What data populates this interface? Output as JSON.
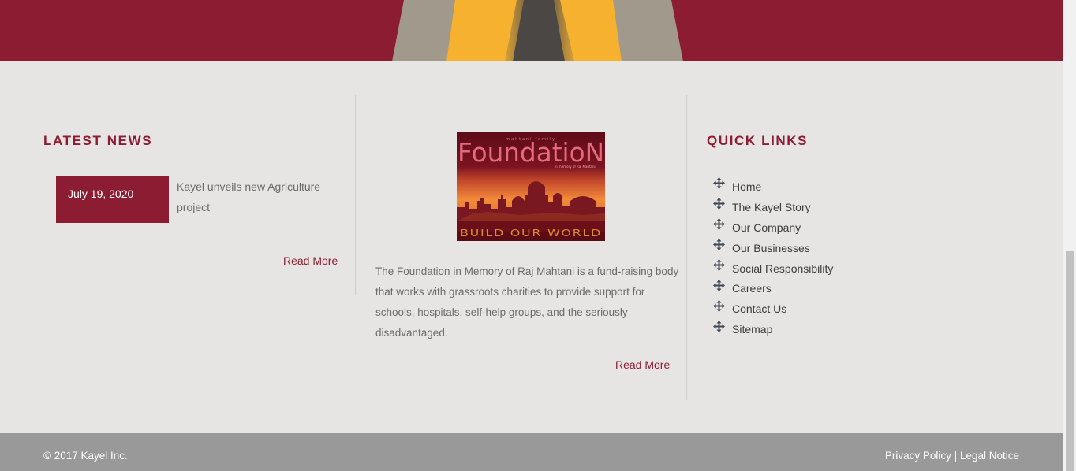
{
  "colors": {
    "brand": "#8b1c31",
    "background": "#e6e5e3",
    "footer": "#999999"
  },
  "latest_news": {
    "title": "LATEST NEWS",
    "items": [
      {
        "date": "July 19, 2020",
        "title": "Kayel unveils new Agriculture project"
      }
    ],
    "read_more": "Read More"
  },
  "foundation": {
    "image": {
      "small_caption": "mahtani family",
      "title": "FoundatioN",
      "sub_caption": "in memory of Raj Mahtani",
      "tagline": "BUILD OUR WORLD"
    },
    "description": "The Foundation in Memory of Raj Mahtani is a fund-raising body that works with grassroots charities to provide support for schools, hospitals, self-help groups, and the seriously disadvantaged.",
    "read_more": "Read More"
  },
  "quick_links": {
    "title": "QUICK LINKS",
    "icon": "move-arrows-icon",
    "items": [
      {
        "label": "Home"
      },
      {
        "label": "The Kayel Story"
      },
      {
        "label": "Our Company"
      },
      {
        "label": "Our Businesses"
      },
      {
        "label": "Social Responsibility"
      },
      {
        "label": "Careers"
      },
      {
        "label": "Contact Us"
      },
      {
        "label": "Sitemap"
      }
    ]
  },
  "footer": {
    "copyright": "© 2017 Kayel Inc.",
    "privacy": "Privacy Policy",
    "separator": "|",
    "legal": "Legal Notice"
  }
}
